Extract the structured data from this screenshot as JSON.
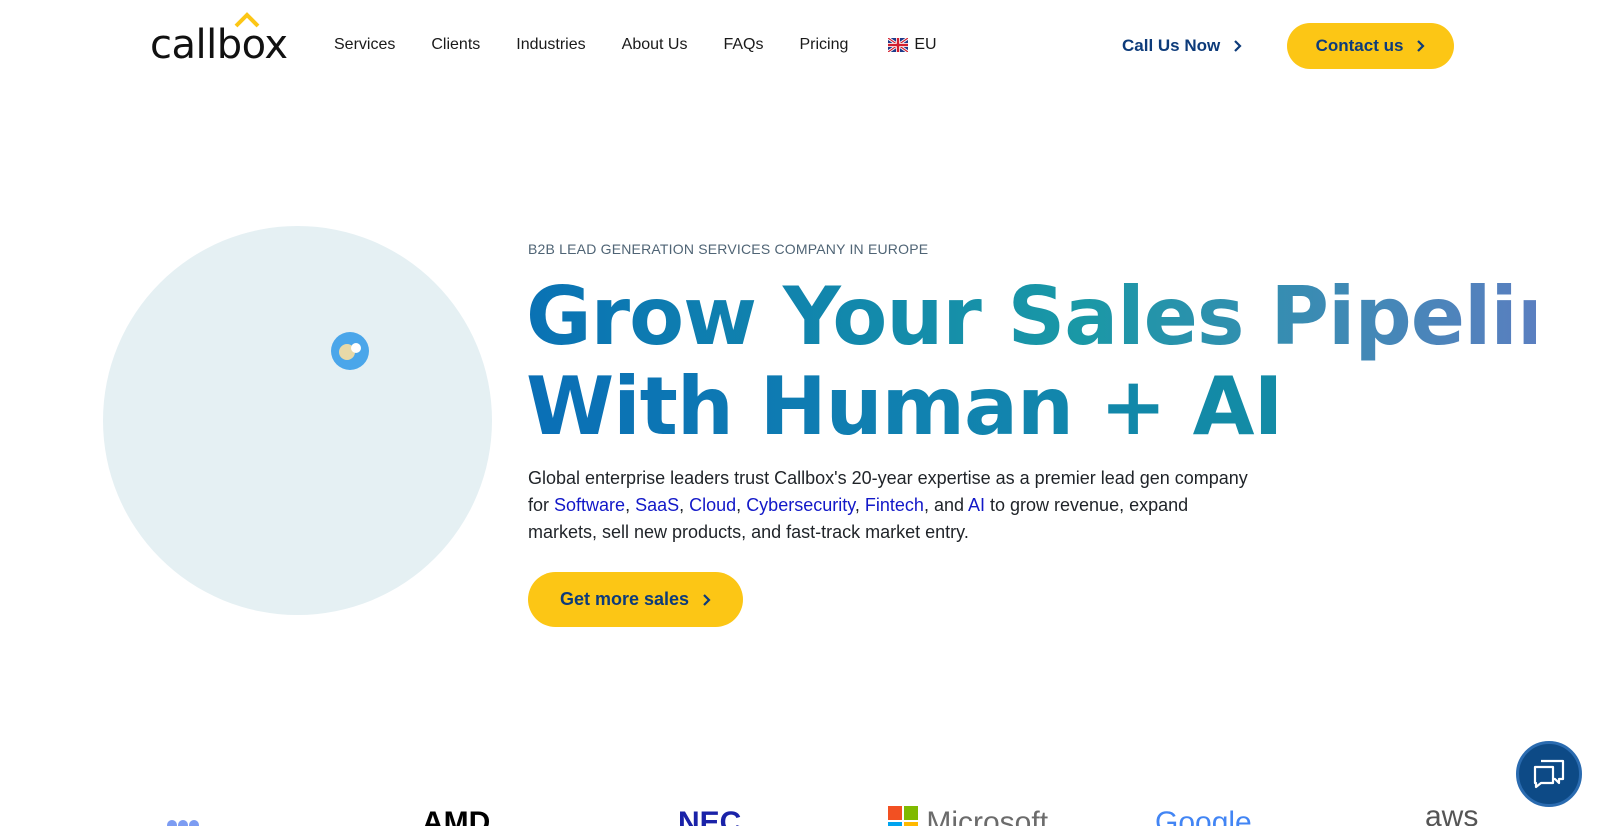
{
  "header": {
    "logo_text": "callbox",
    "nav": [
      "Services",
      "Clients",
      "Industries",
      "About Us",
      "FAQs",
      "Pricing"
    ],
    "region_label": "EU",
    "call_label": "Call Us Now",
    "contact_label": "Contact us"
  },
  "hero": {
    "eyebrow": "B2B LEAD GENERATION SERVICES COMPANY IN EUROPE",
    "headline_line1": "Grow Your Sales Pipeline",
    "headline_line2": "With Human + AI",
    "desc_part1": "Global enterprise leaders trust Callbox's 20-year expertise as a premier lead gen company for ",
    "links": [
      "Software",
      "SaaS",
      "Cloud",
      "Cybersecurity",
      "Fintech",
      "AI"
    ],
    "desc_and": ", and ",
    "desc_part2": " to grow revenue, expand markets, sell new products, and fast-track market entry.",
    "cta_label": "Get more sales"
  },
  "client_logos": [
    "AMD",
    "NEC",
    "Microsoft",
    "Google",
    "aws"
  ],
  "colors": {
    "accent_yellow": "#fcc615",
    "brand_navy": "#0d3b7a",
    "link_blue": "#1218c8",
    "hero_circle": "#e5f0f3"
  },
  "icons": {
    "flag": "uk-flag-icon",
    "chevron": "chevron-right-icon",
    "chat": "chat-bubbles-icon"
  }
}
